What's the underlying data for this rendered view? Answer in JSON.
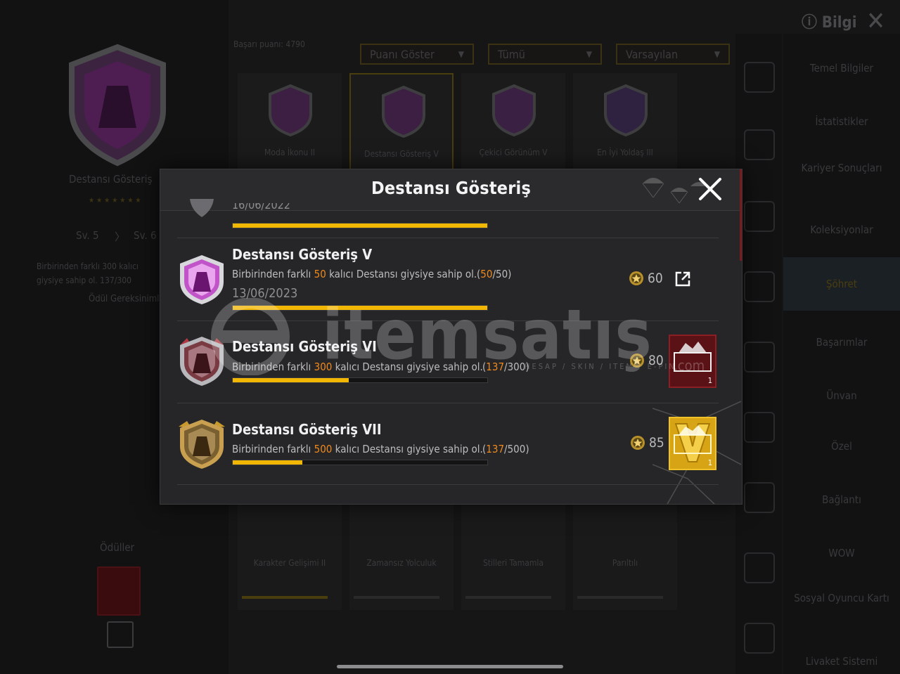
{
  "background": {
    "left_title": "Destansı Gösteriş",
    "left_levels": [
      "Sv. 5",
      "Sv. 6"
    ],
    "left_desc": [
      "Birbirinden farklı 300 kalıcı",
      "giysiye sahip ol. 137/300"
    ],
    "left_link": "Ödül Gereksinimleri",
    "left_rewards_label": "Ödüller",
    "header_info": "Bilgi",
    "filters": [
      "Puanı Göster",
      "Tümü",
      "Varsayılan"
    ],
    "points_line": "Başarı puanı: 4790",
    "grid_labels": [
      "Moda İkonu II",
      "Destansı Gösteriş V",
      "Çekici Görünüm V",
      "En İyi Yoldaş III"
    ],
    "grid_low_labels": [
      "Karakter Gelişimi II",
      "Zamansız Yolculuk",
      "Stilleri Tamamla",
      "Parıltılı"
    ],
    "side_menu": [
      "Temel Bilgiler",
      "İstatistikler",
      "Kariyer Sonuçları",
      "Koleksiyonlar",
      "Şöhret",
      "Başarımlar",
      "Ünvan",
      "Özel",
      "Bağlantı",
      "WOW",
      "Sosyal Oyuncu Kartı",
      "Livaket Sistemi"
    ]
  },
  "modal": {
    "title": "Destansı Gösteriş",
    "prev_row": {
      "date": "16/06/2022",
      "progress": 1.0
    },
    "rows": [
      {
        "title": "Destansı Gösteriş V",
        "desc_prefix": "Birbirinden farklı ",
        "desc_highlight": "50",
        "desc_suffix": " kalıcı Destansı giysiye sahip ol.",
        "progress_current": "50",
        "progress_total": "/50",
        "progress": 1.0,
        "date": "13/06/2023",
        "points": "60",
        "tier_color": "#c054c8"
      },
      {
        "title": "Destansı Gösteriş VI",
        "desc_prefix": "Birbirinden farklı ",
        "desc_highlight": "300",
        "desc_suffix": " kalıcı Destansı giysiye sahip ol.",
        "progress_current": "137",
        "progress_total": "/300",
        "progress": 0.4567,
        "points": "80",
        "reward_count": "1",
        "tier_color": "#9a3a42"
      },
      {
        "title": "Destansı Gösteriş VII",
        "desc_prefix": "Birbirinden farklı ",
        "desc_highlight": "500",
        "desc_suffix": " kalıcı Destansı giysiye sahip ol.",
        "progress_current": "137",
        "progress_total": "/500",
        "progress": 0.274,
        "points": "85",
        "reward_count": "1",
        "tier_color": "#a8852a"
      }
    ]
  },
  "watermark": {
    "brand": "itemsatış",
    "sub": "HESAP / SKIN / ITEM / E-PIN",
    "com": ".com"
  },
  "colors": {
    "accent_gold": "#f2b705",
    "highlight_orange": "#f08a1c"
  }
}
